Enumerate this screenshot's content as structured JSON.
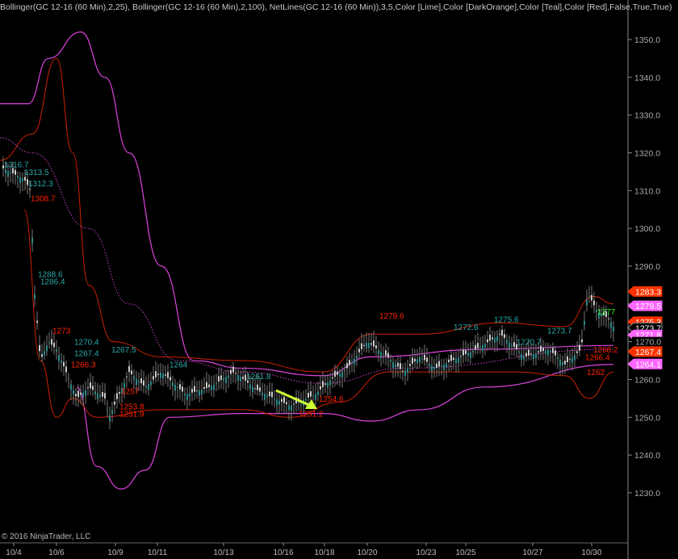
{
  "title": "Bollinger(GC 12-16 (60 Min),2,25), Bollinger(GC 12-16 (60 Min),2,100), NetLines(GC 12-16 (60 Min)),3,5,Color [Lime],Color [DarkOrange],Color [Teal],Color [Red],False,True,True)",
  "copyright": "© 2016 NinjaTrader, LLC",
  "chart_data": {
    "type": "line",
    "instrument": "GC 12-16 (60 Min)",
    "ylim": [
      1225,
      1360
    ],
    "y_ticks": [
      1230,
      1240,
      1250,
      1260,
      1270,
      1280,
      1290,
      1300,
      1310,
      1320,
      1330,
      1340,
      1350
    ],
    "x_tick_labels": [
      "10/4",
      "10/6",
      "10/9",
      "10/11",
      "10/13",
      "10/16",
      "10/18",
      "10/20",
      "10/23",
      "10/25",
      "10/27",
      "10/30"
    ],
    "x_tick_pos": [
      17,
      70,
      143,
      195,
      277,
      351,
      402,
      455,
      528,
      577,
      660,
      733
    ],
    "price": [
      [
        3,
        1316
      ],
      [
        30,
        1313
      ],
      [
        38,
        1310
      ],
      [
        42,
        1285
      ],
      [
        50,
        1265
      ],
      [
        60,
        1270
      ],
      [
        70,
        1268
      ],
      [
        80,
        1263
      ],
      [
        95,
        1255
      ],
      [
        110,
        1258
      ],
      [
        130,
        1255
      ],
      [
        135,
        1250
      ],
      [
        160,
        1262
      ],
      [
        180,
        1258
      ],
      [
        200,
        1262
      ],
      [
        230,
        1256
      ],
      [
        260,
        1258
      ],
      [
        290,
        1262
      ],
      [
        320,
        1257
      ],
      [
        340,
        1255
      ],
      [
        360,
        1253
      ],
      [
        390,
        1256
      ],
      [
        410,
        1260
      ],
      [
        430,
        1263
      ],
      [
        455,
        1270
      ],
      [
        480,
        1266
      ],
      [
        500,
        1262
      ],
      [
        520,
        1266
      ],
      [
        540,
        1263
      ],
      [
        560,
        1265
      ],
      [
        590,
        1268
      ],
      [
        620,
        1272
      ],
      [
        650,
        1266
      ],
      [
        680,
        1268
      ],
      [
        700,
        1264
      ],
      [
        720,
        1268
      ],
      [
        728,
        1283
      ],
      [
        740,
        1278
      ],
      [
        755,
        1276
      ],
      [
        762,
        1273
      ]
    ],
    "bb100_upper": [
      [
        0,
        1333
      ],
      [
        35,
        1333
      ],
      [
        60,
        1345
      ],
      [
        100,
        1352
      ],
      [
        130,
        1340
      ],
      [
        160,
        1320
      ],
      [
        200,
        1290
      ],
      [
        240,
        1265
      ],
      [
        300,
        1263
      ],
      [
        400,
        1261
      ],
      [
        460,
        1266
      ],
      [
        600,
        1268
      ],
      [
        760,
        1269
      ]
    ],
    "bb100_middle": [
      [
        0,
        1324
      ],
      [
        40,
        1320
      ],
      [
        110,
        1300
      ],
      [
        160,
        1280
      ],
      [
        220,
        1265
      ],
      [
        300,
        1262
      ],
      [
        400,
        1259
      ],
      [
        500,
        1263
      ],
      [
        760,
        1268
      ]
    ],
    "bb100_lower": [
      [
        95,
        1258
      ],
      [
        120,
        1237
      ],
      [
        150,
        1231
      ],
      [
        180,
        1236
      ],
      [
        210,
        1250
      ],
      [
        300,
        1251
      ],
      [
        400,
        1251
      ],
      [
        460,
        1249
      ],
      [
        520,
        1252
      ],
      [
        600,
        1258
      ],
      [
        760,
        1264
      ]
    ],
    "bb25_upper": [
      [
        0,
        1318
      ],
      [
        40,
        1325
      ],
      [
        70,
        1345
      ],
      [
        90,
        1320
      ],
      [
        110,
        1285
      ],
      [
        140,
        1270
      ],
      [
        200,
        1266
      ],
      [
        300,
        1265
      ],
      [
        400,
        1262
      ],
      [
        460,
        1272
      ],
      [
        520,
        1272
      ],
      [
        620,
        1275
      ],
      [
        700,
        1274
      ],
      [
        735,
        1282
      ],
      [
        760,
        1280
      ]
    ],
    "bb25_lower": [
      [
        30,
        1305
      ],
      [
        50,
        1265
      ],
      [
        70,
        1250
      ],
      [
        90,
        1255
      ],
      [
        120,
        1250
      ],
      [
        200,
        1252
      ],
      [
        300,
        1252
      ],
      [
        360,
        1250
      ],
      [
        420,
        1254
      ],
      [
        480,
        1262
      ],
      [
        560,
        1262
      ],
      [
        640,
        1262
      ],
      [
        700,
        1261
      ],
      [
        730,
        1255
      ],
      [
        760,
        1262
      ]
    ],
    "price_markers": [
      {
        "value": "1283.3",
        "color": "#ff3300"
      },
      {
        "value": "1279.5",
        "color": "#ff66ff"
      },
      {
        "value": "1275.3",
        "color": "#ff3300"
      },
      {
        "value": "1273.7",
        "color": "#000000"
      },
      {
        "value": "1271.8",
        "color": "#ff66ff"
      },
      {
        "value": "1270.0",
        "color": "none"
      },
      {
        "value": "1267.4",
        "color": "#ff3300"
      },
      {
        "value": "1264.1",
        "color": "#ff66ff"
      }
    ],
    "annotations": [
      {
        "text": "1316.7",
        "x": 5,
        "p": 1317,
        "color": "#2aa8a8"
      },
      {
        "text": "1313.5",
        "x": 30,
        "p": 1315,
        "color": "#2aa8a8"
      },
      {
        "text": "1312.3",
        "x": 35,
        "p": 1312,
        "color": "#2aa8a8"
      },
      {
        "text": "1308.7",
        "x": 38,
        "p": 1308,
        "color": "#ff2200"
      },
      {
        "text": "1288.6",
        "x": 47,
        "p": 1288,
        "color": "#2aa8a8"
      },
      {
        "text": "1286.4",
        "x": 50,
        "p": 1286,
        "color": "#2aa8a8"
      },
      {
        "text": "1273",
        "x": 65,
        "p": 1273,
        "color": "#ff2200"
      },
      {
        "text": "1270.4",
        "x": 92,
        "p": 1270,
        "color": "#2aa8a8"
      },
      {
        "text": "1267.5",
        "x": 138,
        "p": 1268,
        "color": "#2aa8a8"
      },
      {
        "text": "1267.4",
        "x": 92,
        "p": 1267,
        "color": "#2aa8a8"
      },
      {
        "text": "1266.3",
        "x": 88,
        "p": 1264,
        "color": "#ff2200"
      },
      {
        "text": "1264",
        "x": 210,
        "p": 1264,
        "color": "#2aa8a8"
      },
      {
        "text": "1253.8",
        "x": 148,
        "p": 1253,
        "color": "#ff2200"
      },
      {
        "text": "1251.9",
        "x": 148,
        "p": 1251,
        "color": "#ff2200"
      },
      {
        "text": "1257",
        "x": 150,
        "p": 1257,
        "color": "#ff2200"
      },
      {
        "text": "1261.8",
        "x": 305,
        "p": 1261,
        "color": "#2aa8a8"
      },
      {
        "text": "1254.6",
        "x": 395,
        "p": 1255,
        "color": "#ff2200"
      },
      {
        "text": "1251.2",
        "x": 370,
        "p": 1251,
        "color": "#ff2200"
      },
      {
        "text": "1279.6",
        "x": 470,
        "p": 1277,
        "color": "#ff2200"
      },
      {
        "text": "1272.6",
        "x": 562,
        "p": 1274,
        "color": "#2aa8a8"
      },
      {
        "text": "1275.6",
        "x": 612,
        "p": 1276,
        "color": "#2aa8a8"
      },
      {
        "text": "1270.7",
        "x": 640,
        "p": 1270,
        "color": "#2aa8a8"
      },
      {
        "text": "1273.7",
        "x": 678,
        "p": 1273,
        "color": "#2aa8a8"
      },
      {
        "text": "1268.2",
        "x": 735,
        "p": 1268,
        "color": "#ff2200"
      },
      {
        "text": "1266.4",
        "x": 725,
        "p": 1266,
        "color": "#ff2200"
      },
      {
        "text": "1262",
        "x": 727,
        "p": 1262,
        "color": "#ff2200"
      },
      {
        "text": "1277",
        "x": 740,
        "p": 1278,
        "color": "#33ee33"
      }
    ],
    "arrow_color": "#ccff33"
  }
}
